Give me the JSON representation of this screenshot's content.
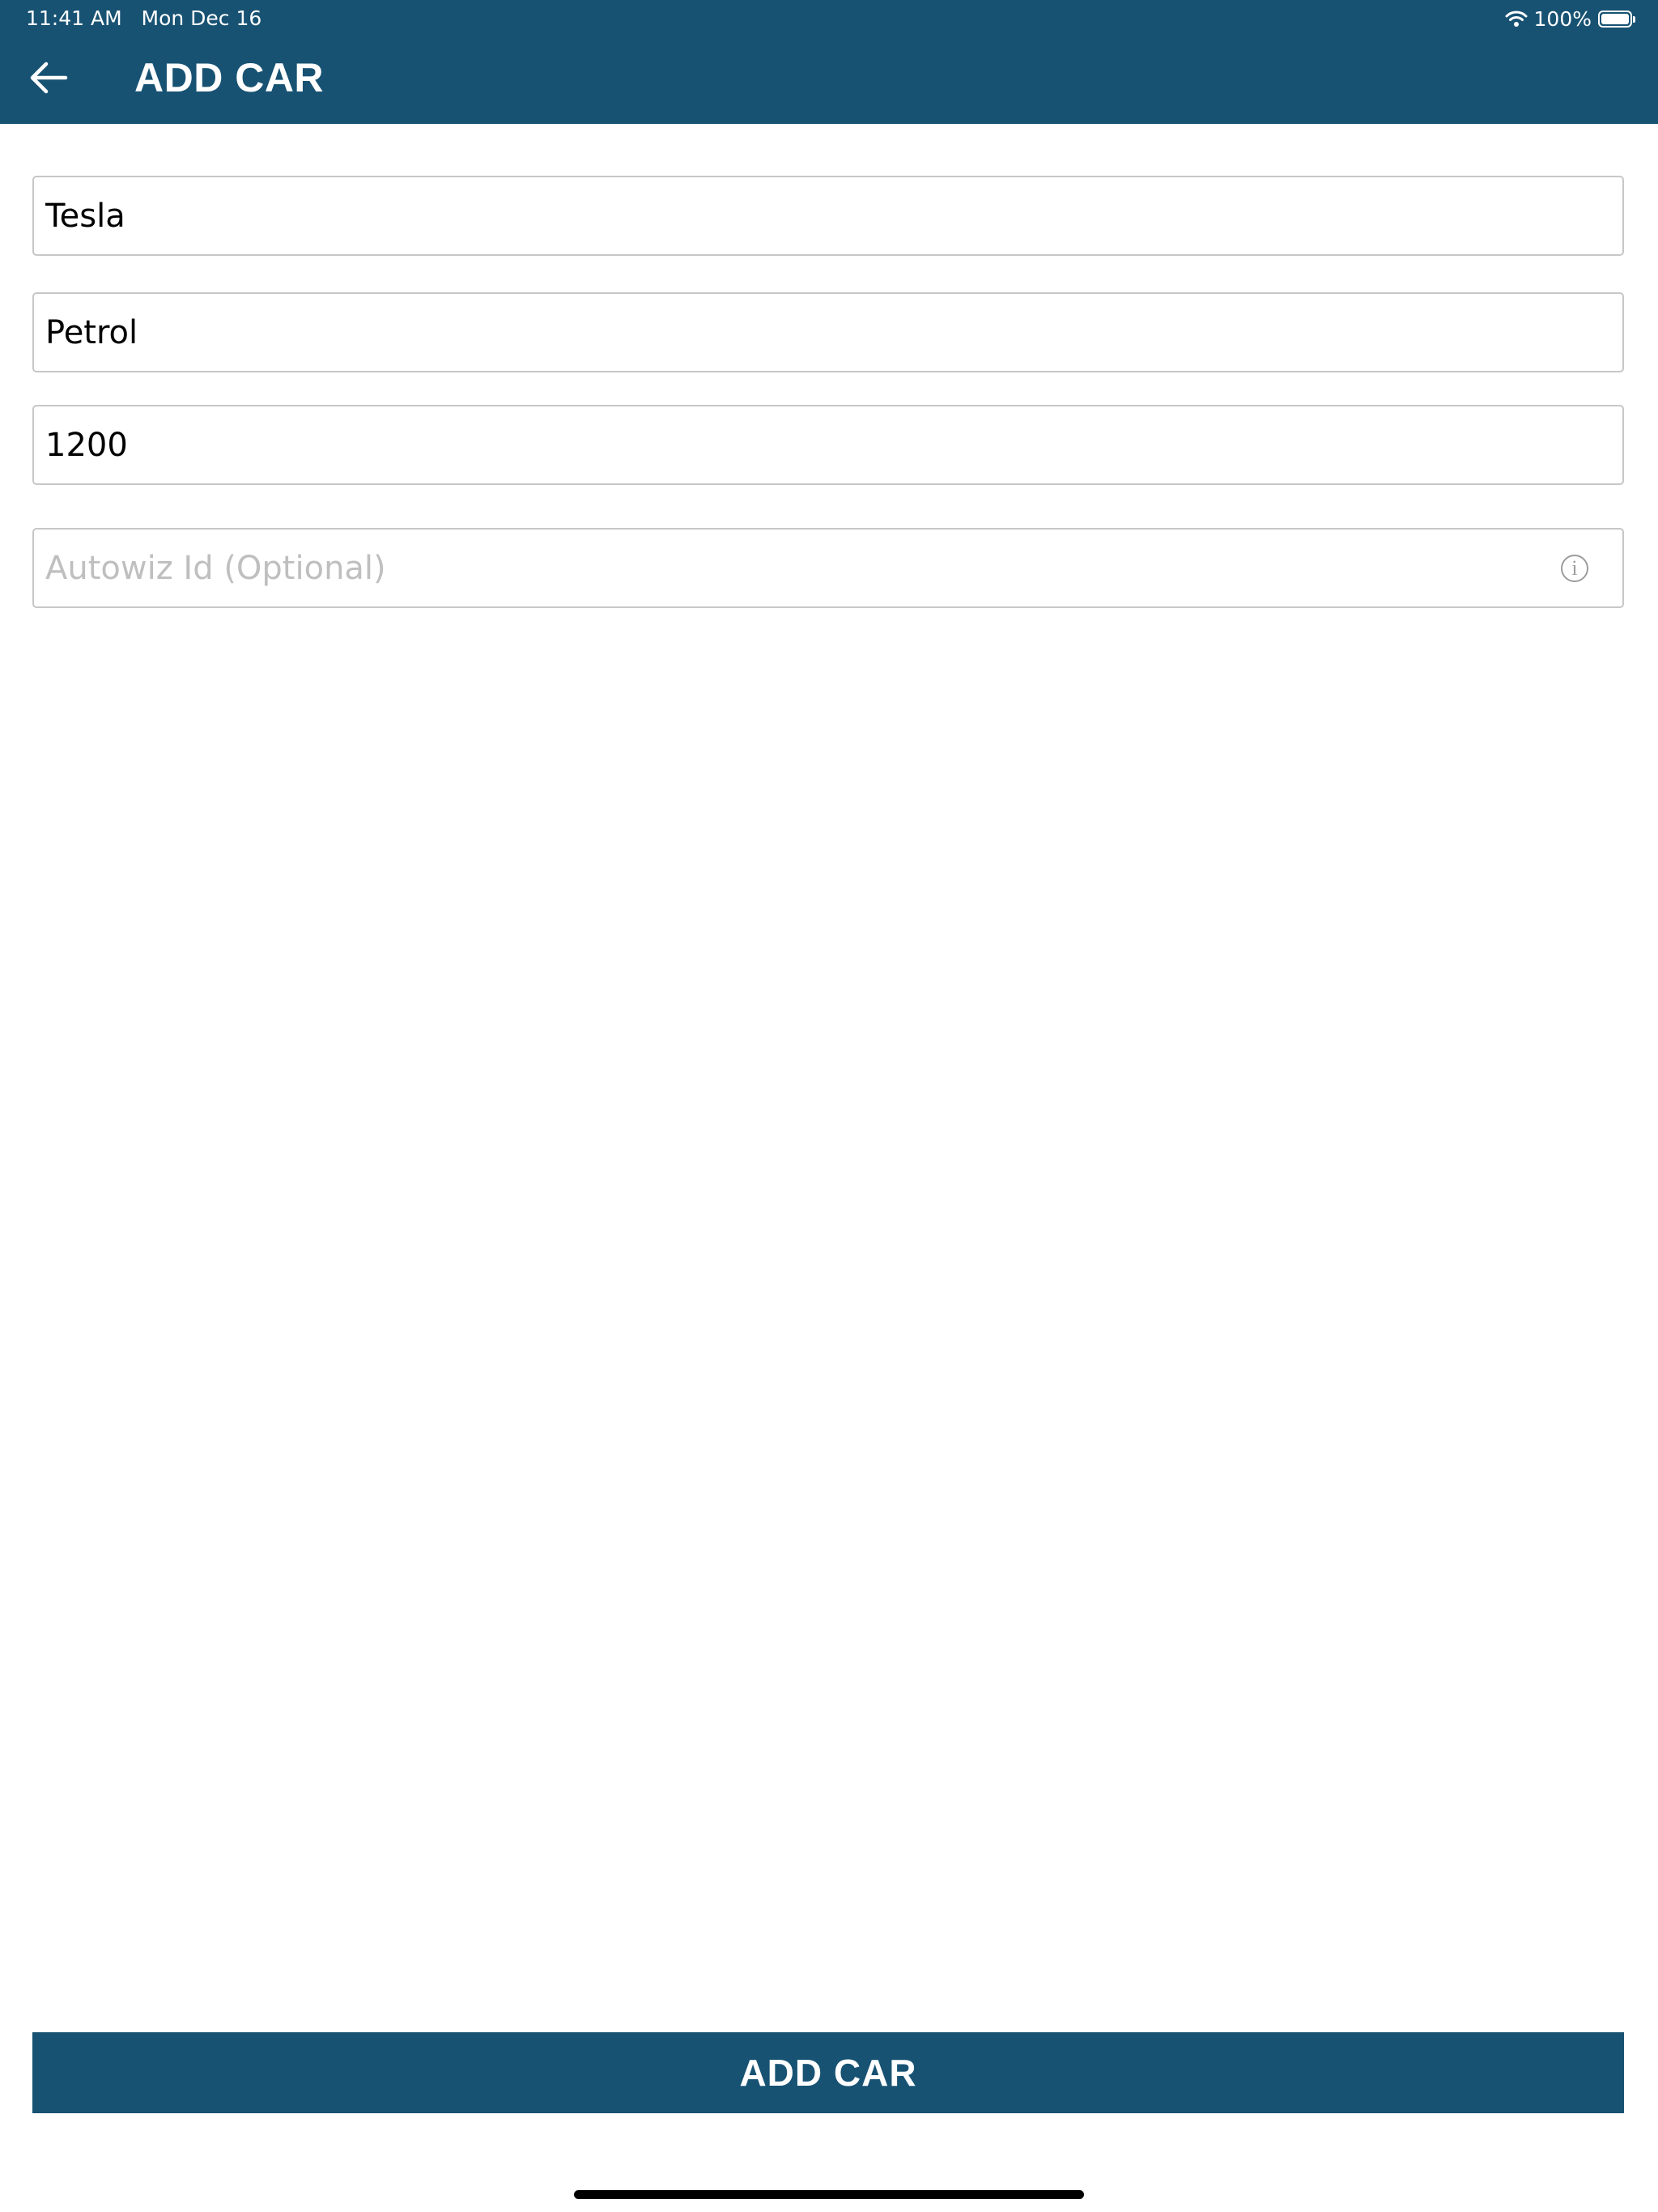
{
  "status_bar": {
    "time": "11:41 AM",
    "date": "Mon Dec 16",
    "battery": "100%",
    "battery_level": 1.0,
    "wifi_icon": "wifi-icon",
    "battery_icon": "battery-icon"
  },
  "header": {
    "title": "ADD CAR",
    "back_icon": "arrow-left-icon",
    "background_color": "#175273"
  },
  "form": {
    "make": {
      "value": "Tesla",
      "placeholder": ""
    },
    "fuel_type": {
      "value": "Petrol",
      "placeholder": ""
    },
    "capacity": {
      "value": "1200",
      "placeholder": ""
    },
    "autowiz_id": {
      "value": "",
      "placeholder": "Autowiz Id (Optional)",
      "info_icon": "info-icon",
      "info_symbol": "i"
    }
  },
  "actions": {
    "submit_label": "ADD CAR",
    "accent_color": "#175273"
  }
}
